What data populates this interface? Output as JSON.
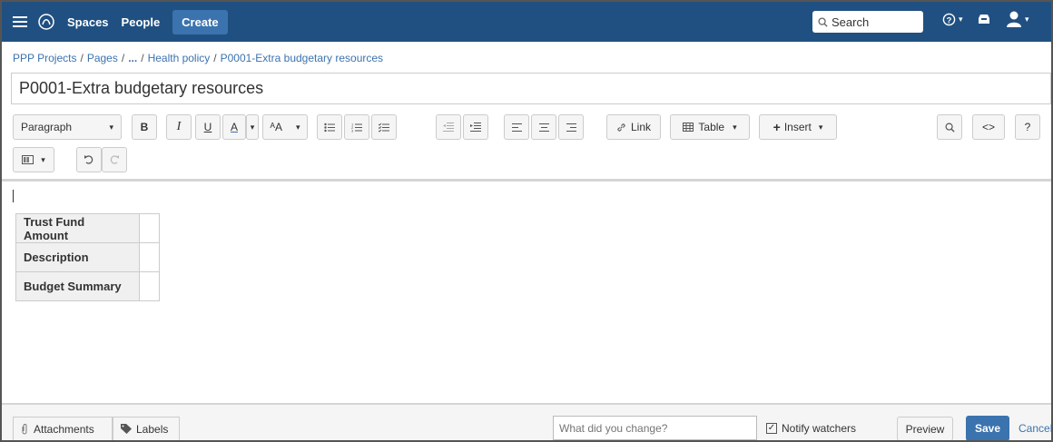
{
  "nav": {
    "spaces": "Spaces",
    "people": "People",
    "create": "Create",
    "search_placeholder": "Search"
  },
  "breadcrumb": [
    "PPP Projects",
    "Pages",
    "...",
    "Health policy",
    "P0001-Extra budgetary resources"
  ],
  "page": {
    "title": "P0001-Extra budgetary resources"
  },
  "toolbar": {
    "paragraph": "Paragraph",
    "bold": "B",
    "italic": "I",
    "underline": "U",
    "text_color": "A",
    "text_style": "ᴬA",
    "link": "Link",
    "table": "Table",
    "insert": "Insert",
    "source": "<>",
    "help": "?"
  },
  "content": {
    "table_rows": [
      "Trust Fund Amount",
      "Description",
      "Budget Summary"
    ]
  },
  "footer": {
    "attachments": "Attachments",
    "labels": "Labels",
    "change_placeholder": "What did you change?",
    "notify": "Notify watchers",
    "preview": "Preview",
    "save": "Save",
    "cancel": "Cancel"
  },
  "colors": {
    "header_bg": "#205081",
    "accent": "#3b73af"
  }
}
